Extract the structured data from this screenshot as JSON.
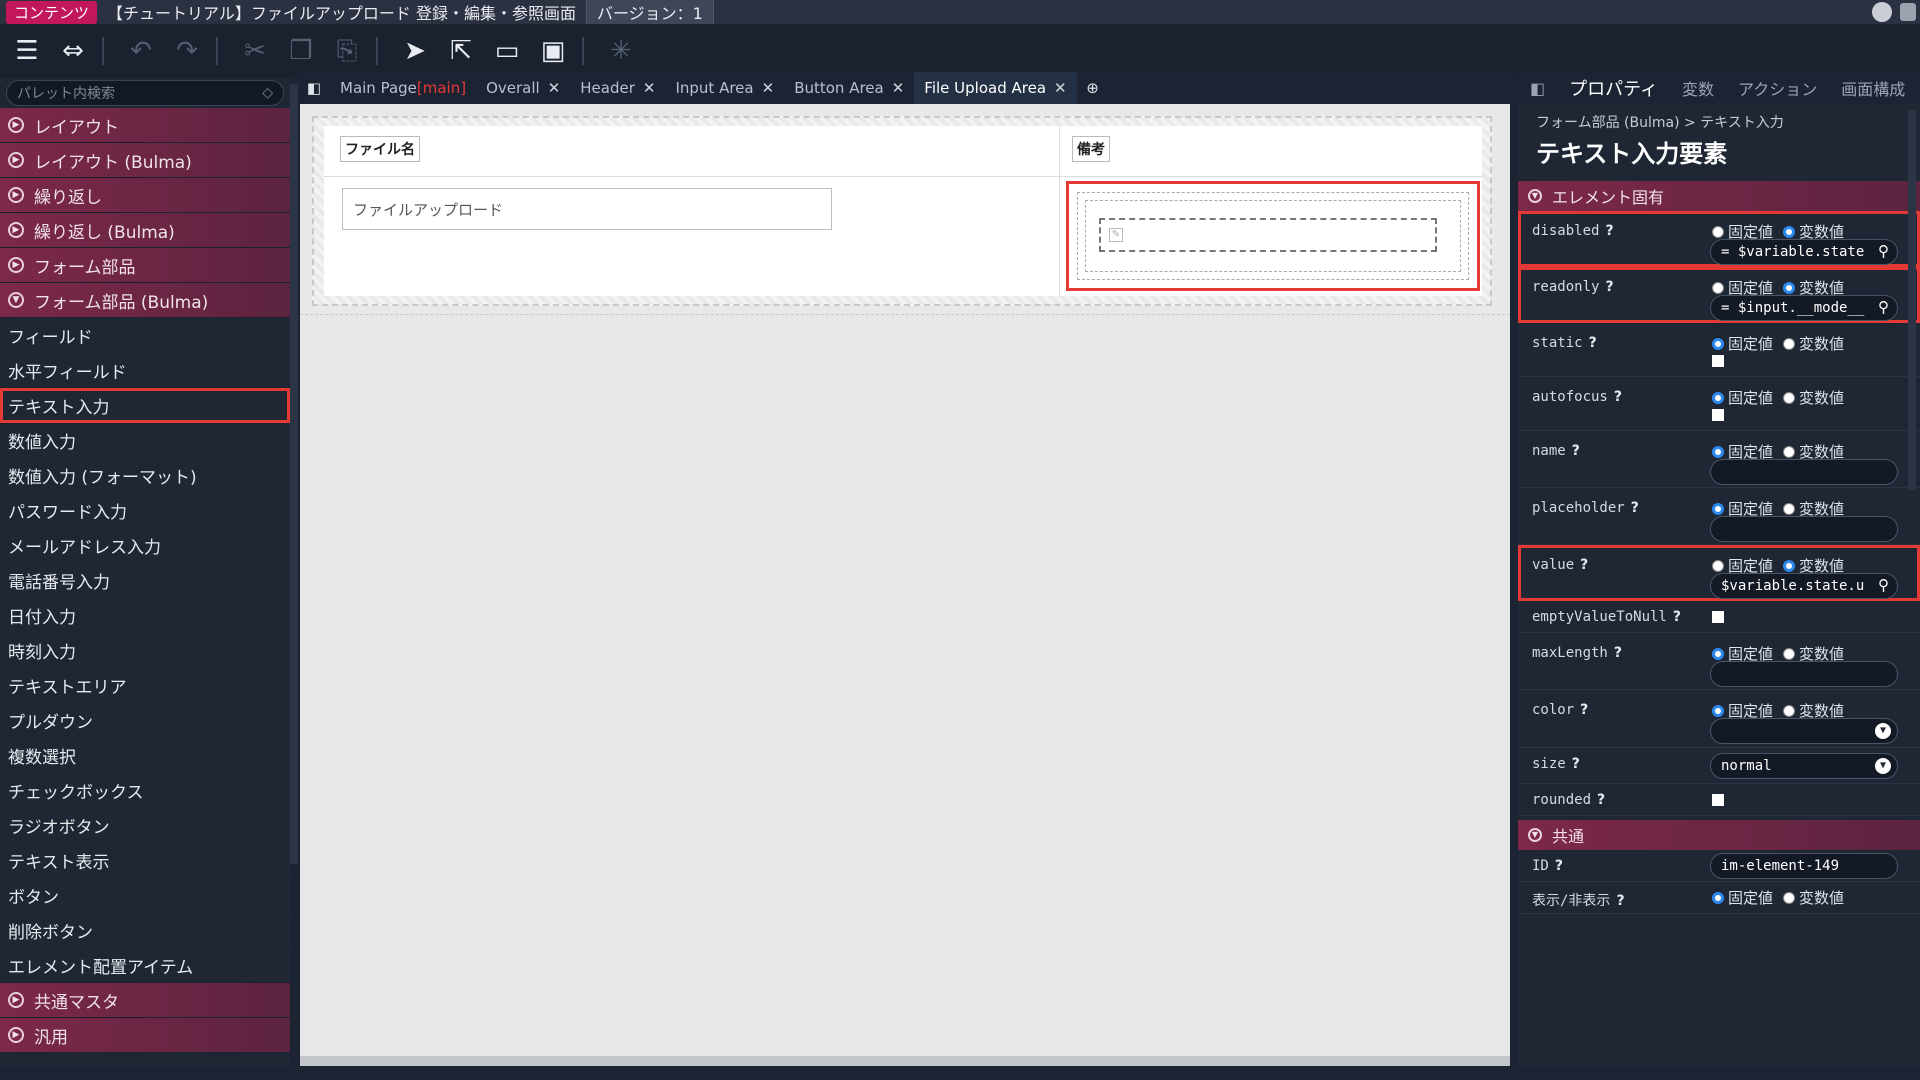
{
  "titlebar": {
    "badge": "コンテンツ",
    "title": "【チュートリアル】ファイルアップロード 登録・編集・参照画面",
    "version": "バージョン：1"
  },
  "palette": {
    "search_placeholder": "パレット内検索",
    "categories_top": [
      "レイアウト",
      "レイアウト (Bulma)",
      "繰り返し",
      "繰り返し (Bulma)",
      "フォーム部品",
      "フォーム部品 (Bulma)"
    ],
    "elements": [
      "フィールド",
      "水平フィールド",
      "テキスト入力",
      "数値入力",
      "数値入力 (フォーマット)",
      "パスワード入力",
      "メールアドレス入力",
      "電話番号入力",
      "日付入力",
      "時刻入力",
      "テキストエリア",
      "プルダウン",
      "複数選択",
      "チェックボックス",
      "ラジオボタン",
      "テキスト表示",
      "ボタン",
      "削除ボタン",
      "エレメント配置アイテム"
    ],
    "categories_bottom": [
      "共通マスタ",
      "汎用"
    ]
  },
  "tabs": [
    {
      "label": "Main Page",
      "mark": "[main]"
    },
    {
      "label": "Overall"
    },
    {
      "label": "Header"
    },
    {
      "label": "Input Area"
    },
    {
      "label": "Button Area"
    },
    {
      "label": "File Upload Area"
    }
  ],
  "canvas": {
    "col1_header": "ファイル名",
    "col2_header": "備考",
    "file_upload_label": "ファイルアップロード"
  },
  "props": {
    "tabs": [
      "プロパティ",
      "変数",
      "アクション",
      "画面構成"
    ],
    "breadcrumb": "フォーム部品 (Bulma)  >  テキスト入力",
    "title": "テキスト入力要素",
    "section_specific": "エレメント固有",
    "section_common": "共通",
    "radio_fixed": "固定値",
    "radio_var": "変数値",
    "rows": {
      "disabled": {
        "name": "disabled",
        "value": "= $variable.state"
      },
      "readonly": {
        "name": "readonly",
        "value": "= $input.__mode__"
      },
      "static": {
        "name": "static"
      },
      "autofocus": {
        "name": "autofocus"
      },
      "name": {
        "name": "name"
      },
      "placeholder": {
        "name": "placeholder"
      },
      "value": {
        "name": "value",
        "value": "$variable.state.u"
      },
      "emptyValueToNull": {
        "name": "emptyValueToNull"
      },
      "maxLength": {
        "name": "maxLength"
      },
      "color": {
        "name": "color"
      },
      "size": {
        "name": "size",
        "value": "normal"
      },
      "rounded": {
        "name": "rounded"
      },
      "id": {
        "name": "ID",
        "value": "im-element-149"
      },
      "visibility": {
        "name": "表示/非表示"
      }
    }
  }
}
